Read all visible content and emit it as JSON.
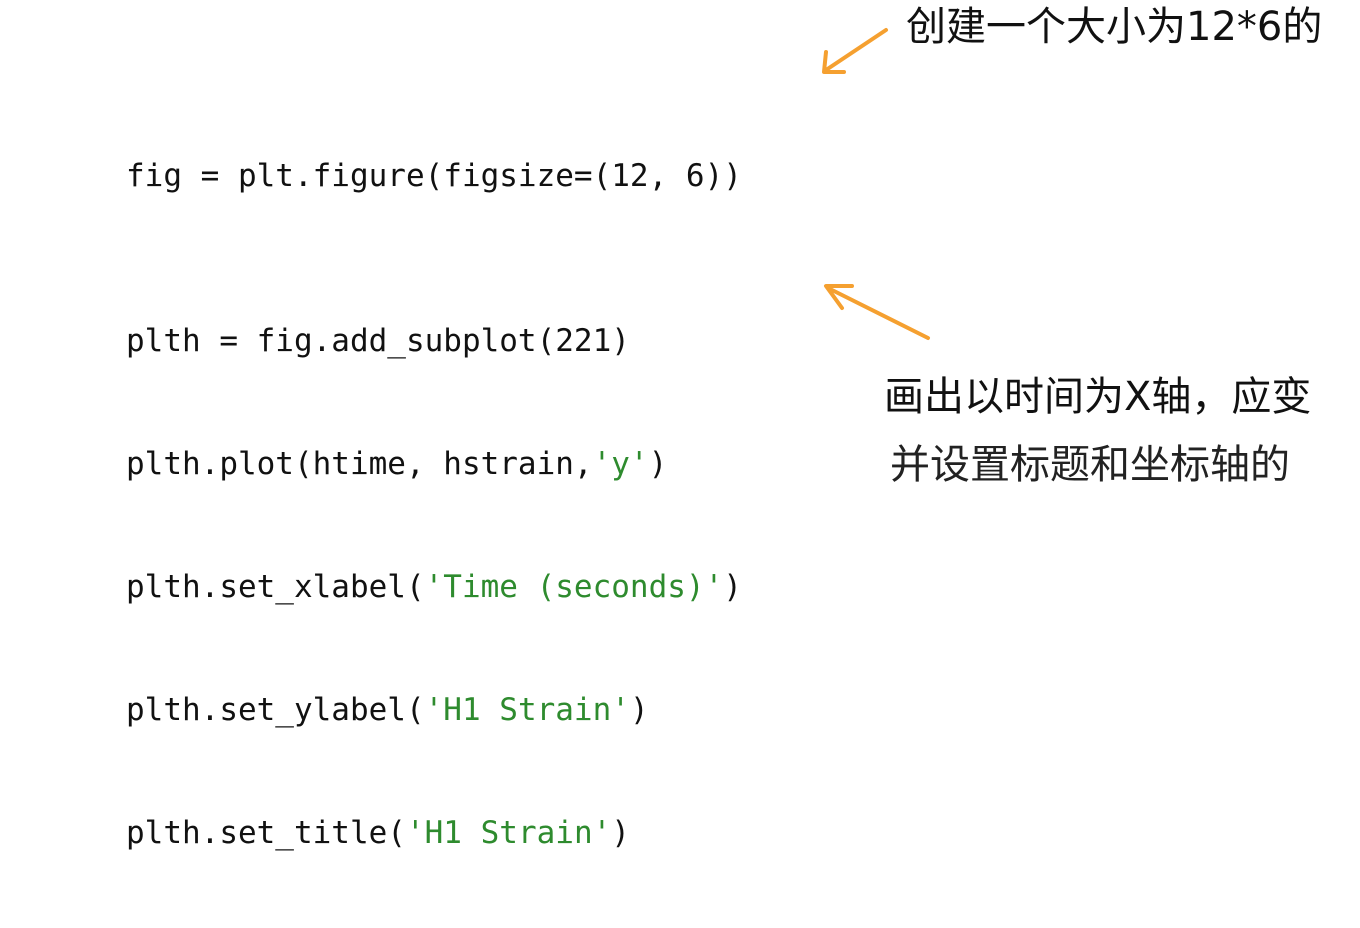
{
  "code": {
    "lines": [
      "fig = plt.figure(figsize=(12, 6))",
      "plth = fig.add_subplot(221)",
      "plth.plot(htime, hstrain,",
      "'y'",
      ")",
      "plth.set_xlabel(",
      "'Time (seconds)'",
      ")",
      "plth.set_ylabel(",
      "'H1 Strain'",
      ")",
      "plth.set_title(",
      "'H1 Strain'",
      ")"
    ]
  },
  "annotations": {
    "top": "创建一个大小为12*6的",
    "bottom_line1": "画出以时间为X轴，应变",
    "bottom_line2": "并设置标题和坐标轴的"
  },
  "colors": {
    "string_literal": "#2e8b2e",
    "arrow": "#f5a030",
    "text": "#111111"
  },
  "icons": {
    "arrow_top": "arrow-left-down-icon",
    "arrow_bottom": "arrow-left-up-icon"
  }
}
